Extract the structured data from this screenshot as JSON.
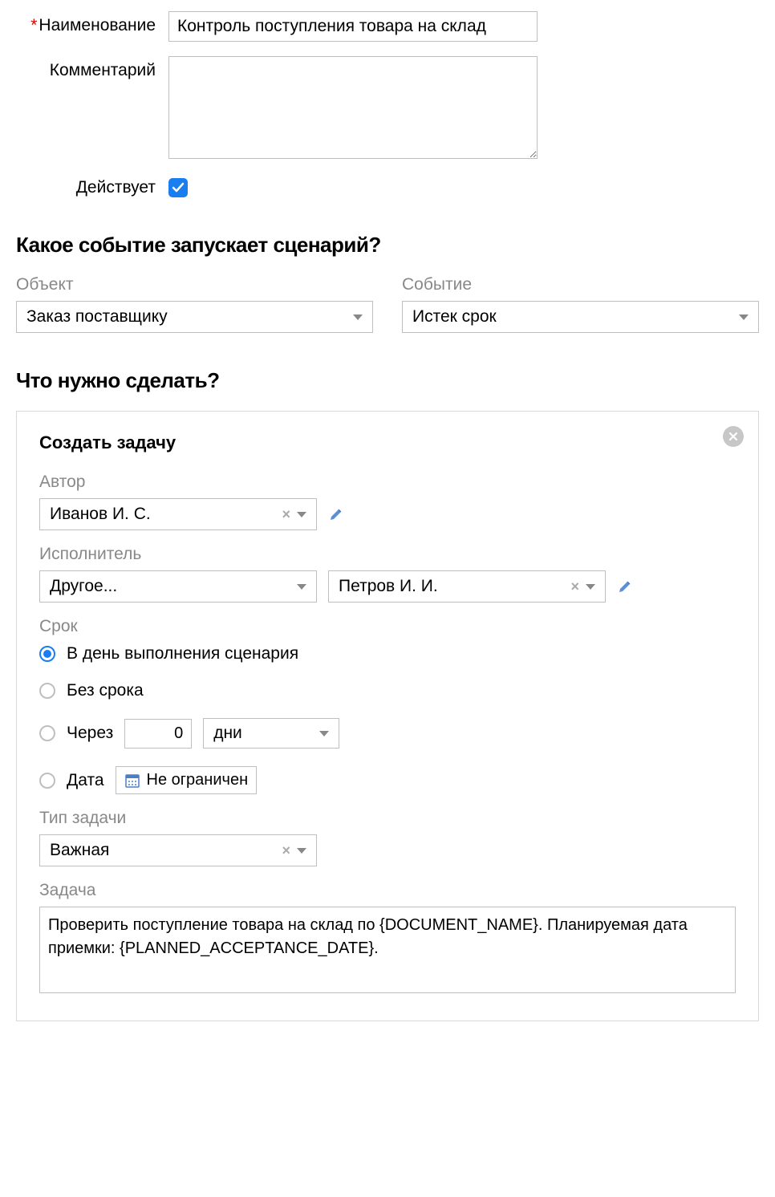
{
  "form": {
    "name_label": "Наименование",
    "name_value": "Контроль поступления товара на склад",
    "comment_label": "Комментарий",
    "comment_value": "",
    "active_label": "Действует",
    "active_checked": true
  },
  "trigger": {
    "section_title": "Какое событие запускает сценарий?",
    "object_label": "Объект",
    "object_value": "Заказ поставщику",
    "event_label": "Событие",
    "event_value": "Истек срок"
  },
  "action_section_title": "Что нужно сделать?",
  "action": {
    "title": "Создать задачу",
    "author_label": "Автор",
    "author_value": "Иванов И. С.",
    "executor_label": "Исполнитель",
    "executor_mode": "Другое...",
    "executor_value": "Петров И. И.",
    "deadline_label": "Срок",
    "deadline_options": {
      "on_run": "В день выполнения сценария",
      "none": "Без срока",
      "after": "Через",
      "after_num": "0",
      "after_unit": "дни",
      "date": "Дата",
      "date_value": "Не ограничен"
    },
    "deadline_selected": "on_run",
    "task_type_label": "Тип задачи",
    "task_type_value": "Важная",
    "task_text_label": "Задача",
    "task_text_value": "Проверить поступление товара на склад по {DOCUMENT_NAME}. Планируемая дата приемки: {PLANNED_ACCEPTANCE_DATE}."
  }
}
